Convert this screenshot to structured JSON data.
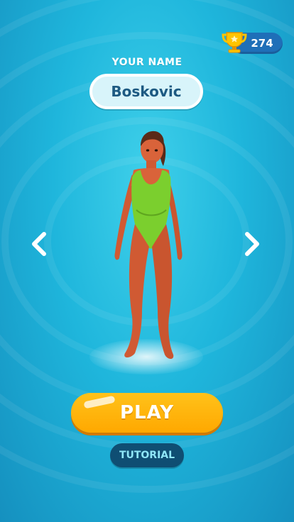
{
  "hud": {
    "trophy_count": "274",
    "trophy_icon": "trophy-icon"
  },
  "profile": {
    "name_label": "YOUR NAME",
    "name_value": "Boskovic"
  },
  "selector": {
    "prev_icon": "chevron-left-icon",
    "next_icon": "chevron-right-icon"
  },
  "actions": {
    "play_label": "PLAY",
    "tutorial_label": "TUTORIAL"
  },
  "colors": {
    "background": "#1fb6dc",
    "play_button": "#ffb000",
    "tutorial_button": "#0f4e73",
    "trophy_pill": "#1f6fb8",
    "swimsuit": "#7bcf2e"
  }
}
